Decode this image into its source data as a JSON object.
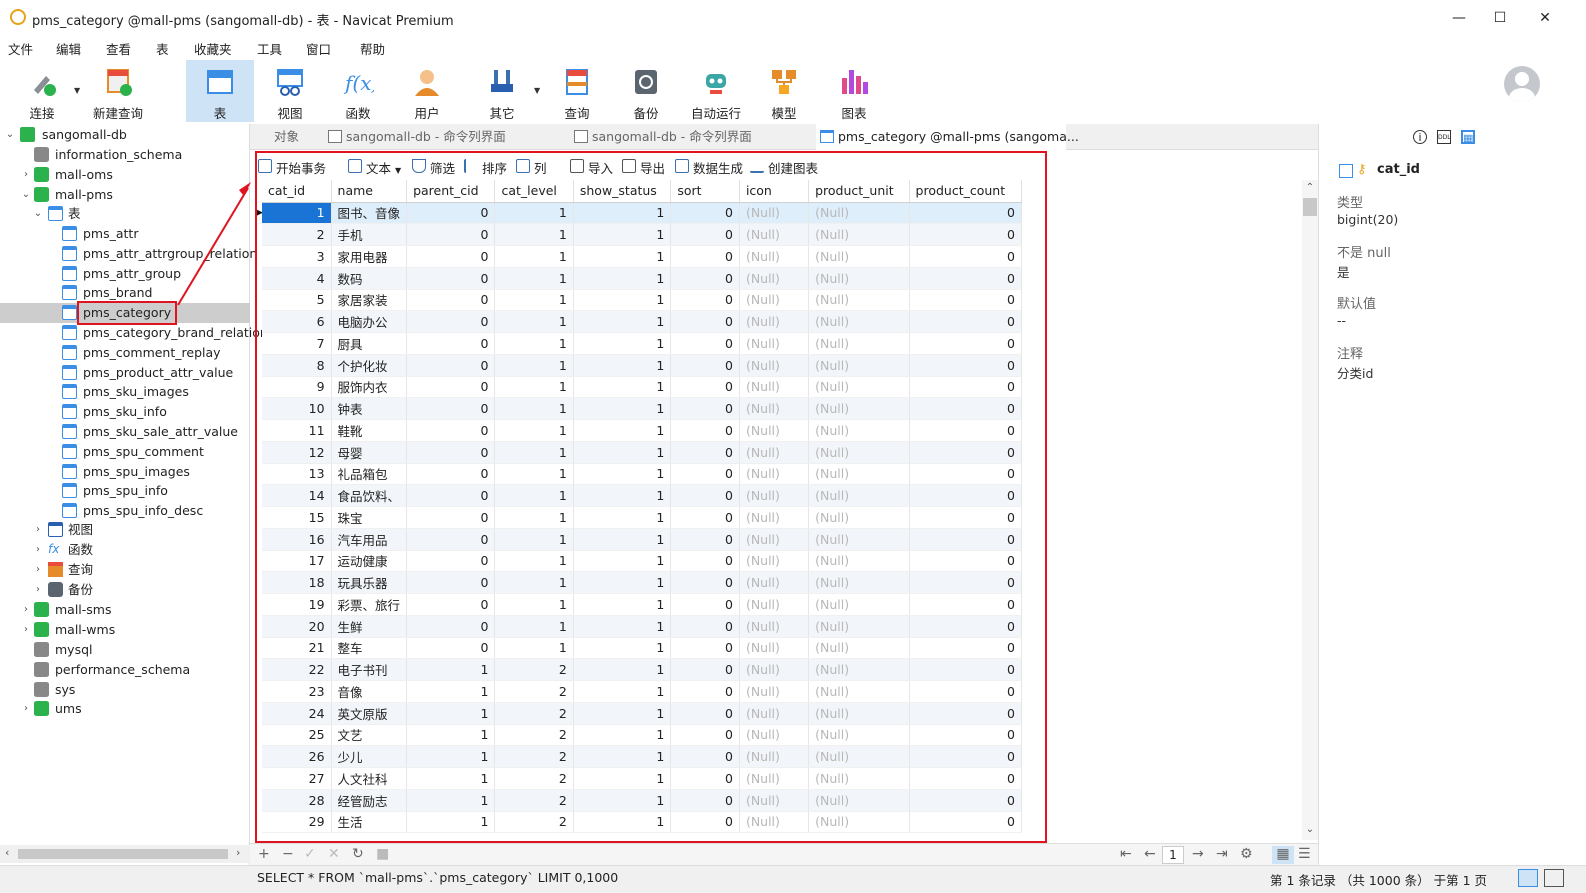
{
  "window": {
    "title": "pms_category @mall-pms (sangomall-db) - 表 - Navicat Premium",
    "minimize": "—",
    "maximize": "☐",
    "close": "✕"
  },
  "menu": [
    "文件",
    "编辑",
    "查看",
    "表",
    "收藏夹",
    "工具",
    "窗口",
    "帮助"
  ],
  "toolbar": [
    {
      "label": "连接",
      "icon": "connection-icon"
    },
    {
      "label": "新建查询",
      "icon": "new-query-icon"
    },
    {
      "label": "表",
      "icon": "table-icon"
    },
    {
      "label": "视图",
      "icon": "view-icon"
    },
    {
      "label": "函数",
      "icon": "function-icon"
    },
    {
      "label": "用户",
      "icon": "user-icon"
    },
    {
      "label": "其它",
      "icon": "other-icon"
    },
    {
      "label": "查询",
      "icon": "query-icon"
    },
    {
      "label": "备份",
      "icon": "backup-icon"
    },
    {
      "label": "自动运行",
      "icon": "robot-icon"
    },
    {
      "label": "模型",
      "icon": "model-icon"
    },
    {
      "label": "图表",
      "icon": "chart-icon"
    }
  ],
  "tree": {
    "root": "sangomall-db",
    "dbs_top": [
      "information_schema",
      "mall-oms",
      "mall-pms"
    ],
    "table_group": "表",
    "tables": [
      "pms_attr",
      "pms_attr_attrgroup_relation",
      "pms_attr_group",
      "pms_brand",
      "pms_category",
      "pms_category_brand_relation",
      "pms_comment_replay",
      "pms_product_attr_value",
      "pms_sku_images",
      "pms_sku_info",
      "pms_sku_sale_attr_value",
      "pms_spu_comment",
      "pms_spu_images",
      "pms_spu_info",
      "pms_spu_info_desc"
    ],
    "groups": [
      "视图",
      "函数",
      "查询",
      "备份"
    ],
    "dbs_bottom": [
      "mall-sms",
      "mall-wms",
      "mysql",
      "performance_schema",
      "sys",
      "ums"
    ]
  },
  "tabs": [
    {
      "label": "对象"
    },
    {
      "label": "sangomall-db - 命令列界面"
    },
    {
      "label": "sangomall-db - 命令列界面"
    },
    {
      "label": "pms_category @mall-pms (sangoma..."
    }
  ],
  "subtoolbar": [
    "开始事务",
    "文本",
    "筛选",
    "排序",
    "列",
    "导入",
    "导出",
    "数据生成",
    "创建图表"
  ],
  "grid": {
    "columns": [
      "cat_id",
      "name",
      "parent_cid",
      "cat_level",
      "show_status",
      "sort",
      "icon",
      "product_unit",
      "product_count"
    ],
    "null_text": "(Null)",
    "rows": [
      [
        "1",
        "图书、音像",
        "0",
        "1",
        "1",
        "0",
        "(Null)",
        "(Null)",
        "0"
      ],
      [
        "2",
        "手机",
        "0",
        "1",
        "1",
        "0",
        "(Null)",
        "(Null)",
        "0"
      ],
      [
        "3",
        "家用电器",
        "0",
        "1",
        "1",
        "0",
        "(Null)",
        "(Null)",
        "0"
      ],
      [
        "4",
        "数码",
        "0",
        "1",
        "1",
        "0",
        "(Null)",
        "(Null)",
        "0"
      ],
      [
        "5",
        "家居家装",
        "0",
        "1",
        "1",
        "0",
        "(Null)",
        "(Null)",
        "0"
      ],
      [
        "6",
        "电脑办公",
        "0",
        "1",
        "1",
        "0",
        "(Null)",
        "(Null)",
        "0"
      ],
      [
        "7",
        "厨具",
        "0",
        "1",
        "1",
        "0",
        "(Null)",
        "(Null)",
        "0"
      ],
      [
        "8",
        "个护化妆",
        "0",
        "1",
        "1",
        "0",
        "(Null)",
        "(Null)",
        "0"
      ],
      [
        "9",
        "服饰内衣",
        "0",
        "1",
        "1",
        "0",
        "(Null)",
        "(Null)",
        "0"
      ],
      [
        "10",
        "钟表",
        "0",
        "1",
        "1",
        "0",
        "(Null)",
        "(Null)",
        "0"
      ],
      [
        "11",
        "鞋靴",
        "0",
        "1",
        "1",
        "0",
        "(Null)",
        "(Null)",
        "0"
      ],
      [
        "12",
        "母婴",
        "0",
        "1",
        "1",
        "0",
        "(Null)",
        "(Null)",
        "0"
      ],
      [
        "13",
        "礼品箱包",
        "0",
        "1",
        "1",
        "0",
        "(Null)",
        "(Null)",
        "0"
      ],
      [
        "14",
        "食品饮料、",
        "0",
        "1",
        "1",
        "0",
        "(Null)",
        "(Null)",
        "0"
      ],
      [
        "15",
        "珠宝",
        "0",
        "1",
        "1",
        "0",
        "(Null)",
        "(Null)",
        "0"
      ],
      [
        "16",
        "汽车用品",
        "0",
        "1",
        "1",
        "0",
        "(Null)",
        "(Null)",
        "0"
      ],
      [
        "17",
        "运动健康",
        "0",
        "1",
        "1",
        "0",
        "(Null)",
        "(Null)",
        "0"
      ],
      [
        "18",
        "玩具乐器",
        "0",
        "1",
        "1",
        "0",
        "(Null)",
        "(Null)",
        "0"
      ],
      [
        "19",
        "彩票、旅行",
        "0",
        "1",
        "1",
        "0",
        "(Null)",
        "(Null)",
        "0"
      ],
      [
        "20",
        "生鲜",
        "0",
        "1",
        "1",
        "0",
        "(Null)",
        "(Null)",
        "0"
      ],
      [
        "21",
        "整车",
        "0",
        "1",
        "1",
        "0",
        "(Null)",
        "(Null)",
        "0"
      ],
      [
        "22",
        "电子书刊",
        "1",
        "2",
        "1",
        "0",
        "(Null)",
        "(Null)",
        "0"
      ],
      [
        "23",
        "音像",
        "1",
        "2",
        "1",
        "0",
        "(Null)",
        "(Null)",
        "0"
      ],
      [
        "24",
        "英文原版",
        "1",
        "2",
        "1",
        "0",
        "(Null)",
        "(Null)",
        "0"
      ],
      [
        "25",
        "文艺",
        "1",
        "2",
        "1",
        "0",
        "(Null)",
        "(Null)",
        "0"
      ],
      [
        "26",
        "少儿",
        "1",
        "2",
        "1",
        "0",
        "(Null)",
        "(Null)",
        "0"
      ],
      [
        "27",
        "人文社科",
        "1",
        "2",
        "1",
        "0",
        "(Null)",
        "(Null)",
        "0"
      ],
      [
        "28",
        "经管励志",
        "1",
        "2",
        "1",
        "0",
        "(Null)",
        "(Null)",
        "0"
      ],
      [
        "29",
        "生活",
        "1",
        "2",
        "1",
        "0",
        "(Null)",
        "(Null)",
        "0"
      ]
    ]
  },
  "nav": {
    "page": "1"
  },
  "status": {
    "sql": "SELECT * FROM `mall-pms`.`pms_category` LIMIT 0,1000",
    "info": "第 1 条记录 （共 1000 条） 于第 1 页"
  },
  "rightpanel": {
    "field": "cat_id",
    "type_label": "类型",
    "type_value": "bigint(20)",
    "notnull_label": "不是 null",
    "notnull_value": "是",
    "default_label": "默认值",
    "default_value": "--",
    "comment_label": "注释",
    "comment_value": "分类id"
  },
  "colors": {
    "accent": "#1a74d6",
    "highlight": "#e0141e",
    "active_tab": "#cfe3f6"
  }
}
